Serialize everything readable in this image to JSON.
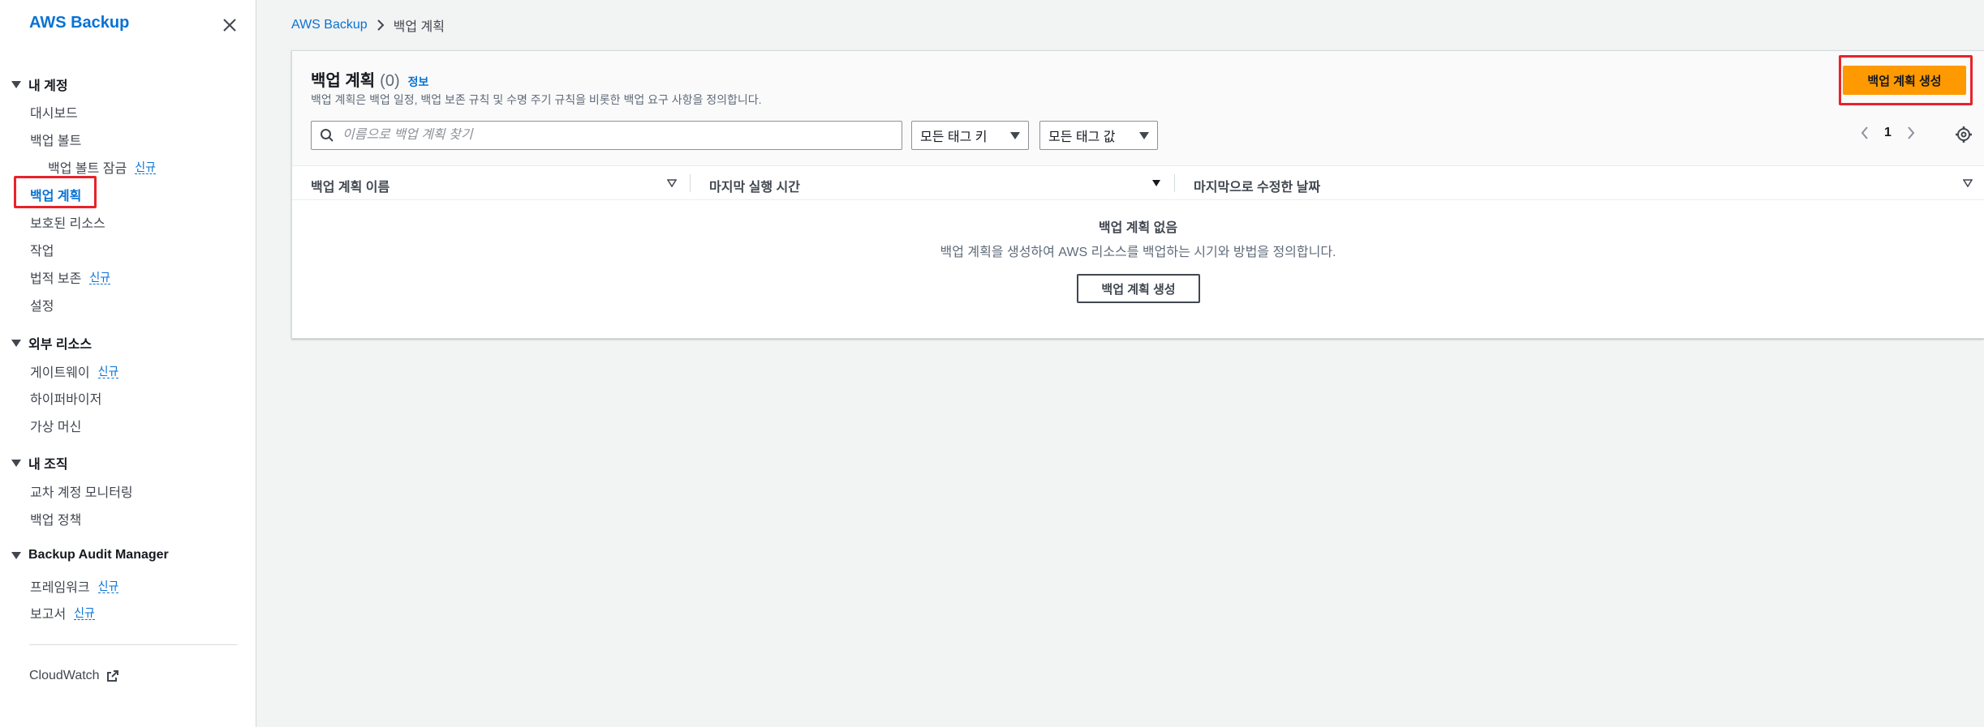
{
  "sidebar": {
    "title": "AWS Backup",
    "sections": [
      {
        "label": "내 계정"
      },
      {
        "label": "외부 리소스"
      },
      {
        "label": "내 조직"
      },
      {
        "label": "Backup Audit Manager"
      }
    ],
    "items": {
      "dashboard": "대시보드",
      "vaults": "백업 볼트",
      "vault_lock": "백업 볼트 잠금",
      "plans": "백업 계획",
      "protected": "보호된 리소스",
      "jobs": "작업",
      "legal_hold": "법적 보존",
      "settings": "설정",
      "gateway": "게이트웨이",
      "hypervisor": "하이퍼바이저",
      "vm": "가상 머신",
      "cross_account": "교차 계정 모니터링",
      "backup_policy": "백업 정책",
      "frameworks": "프레임워크",
      "reports": "보고서",
      "cloudwatch": "CloudWatch"
    },
    "new_badge": "신규"
  },
  "breadcrumb": {
    "root": "AWS Backup",
    "current": "백업 계획"
  },
  "panel": {
    "title": "백업 계획",
    "count": "(0)",
    "info": "정보",
    "description": "백업 계획은 백업 일정, 백업 보존 규칙 및 수명 주기 규칙을 비롯한 백업 요구 사항을 정의합니다.",
    "create_button": "백업 계획 생성",
    "search_placeholder": "이름으로 백업 계획 찾기",
    "tag_key_select": "모든 태그 키",
    "tag_value_select": "모든 태그 값",
    "page": "1",
    "columns": [
      "백업 계획 이름",
      "마지막 실행 시간",
      "마지막으로 수정한 날짜"
    ],
    "empty_title": "백업 계획 없음",
    "empty_desc": "백업 계획을 생성하여 AWS 리소스를 백업하는 시기와 방법을 정의합니다.",
    "empty_button": "백업 계획 생성"
  },
  "colors": {
    "accent": "#0972d3",
    "primary_button": "#ff9900",
    "highlight": "#e8222b"
  },
  "icons": [
    "close-icon",
    "caret-down-icon",
    "external-link-icon",
    "chevron-right-icon",
    "search-icon",
    "chevron-left-icon",
    "settings-icon",
    "sort-icon"
  ]
}
